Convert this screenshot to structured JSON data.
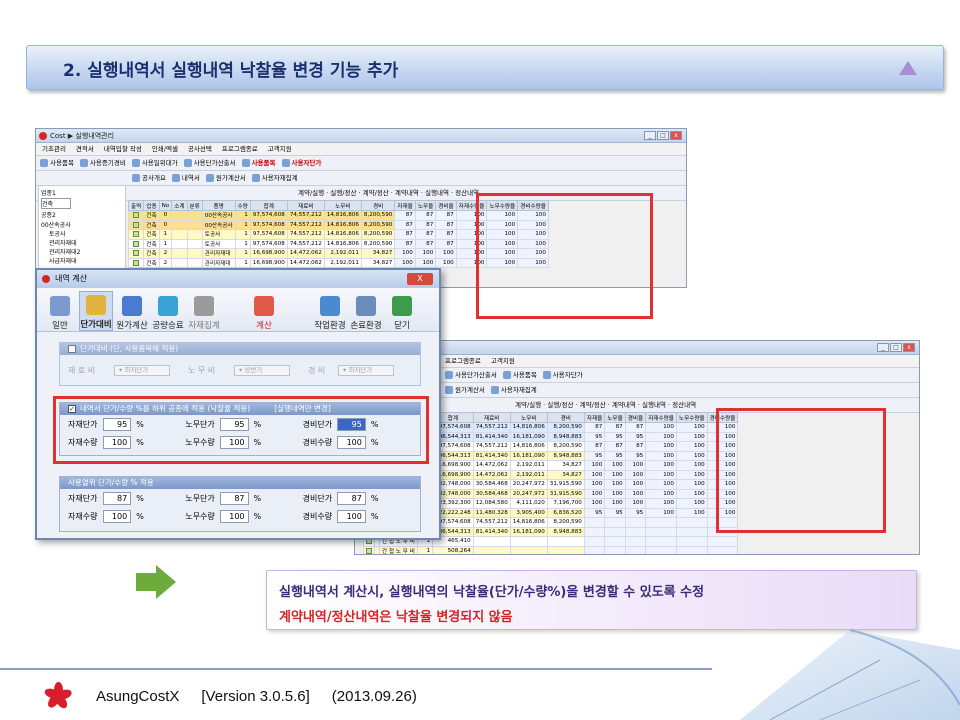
{
  "title": "2. 실행내역서 실행내역 낙찰율 변경 기능 추가",
  "window_back": {
    "title": "Cost ▶ 실행내역관리",
    "menu": [
      "기초관리",
      "견적서",
      "내역입찰 작성",
      "인쇄/엑셀",
      "공사선택",
      "프로그램종료",
      "고객지원"
    ],
    "toolbar": [
      "사용품목",
      "사용증기경비",
      "사용일위대가",
      "사용단가산출서",
      "사용품목",
      "사용자단가"
    ],
    "toolbar_red": [
      "사용품목",
      "사용자단가"
    ],
    "subtool": [
      "공사개요",
      "내역서",
      "원가계산서",
      "사용자재집계"
    ],
    "radio": "계약/실행 · 실행/정산 · 계약/정산 · 계약내역 · 실행내역 · 정산내역",
    "left_labels": [
      "업종1",
      "건축",
      "공종2"
    ],
    "tree": [
      "00산속공사",
      "토공사",
      "관리자재대",
      "관리자재대2",
      "사급자재대"
    ],
    "headers": [
      "출력",
      "업종",
      "No",
      "소계",
      "분류",
      "품명",
      "수량",
      "합계",
      "재료비",
      "노무비",
      "경비",
      "자재율",
      "노무율",
      "경비율",
      "자재수량율",
      "노무수량율",
      "경비수량율"
    ],
    "rows": [
      {
        "cat": "건축",
        "no": "0",
        "name": "00산속공사",
        "qty": "1",
        "sum": "97,574,608",
        "mat": "74,557,212",
        "lab": "14,816,806",
        "exp": "8,200,590",
        "r": [
          "87",
          "87",
          "87",
          "100",
          "100",
          "100"
        ]
      },
      {
        "cat": "건축",
        "no": "0",
        "name": "00산속공사",
        "qty": "1",
        "sum": "97,574,608",
        "mat": "74,557,212",
        "lab": "14,816,806",
        "exp": "8,200,590",
        "r": [
          "87",
          "87",
          "87",
          "100",
          "100",
          "100"
        ]
      },
      {
        "cat": "건축",
        "no": "1",
        "name": "토공사",
        "qty": "1",
        "sum": "97,574,608",
        "mat": "74,557,212",
        "lab": "14,816,806",
        "exp": "8,200,590",
        "r": [
          "87",
          "87",
          "87",
          "100",
          "100",
          "100"
        ]
      },
      {
        "cat": "건축",
        "no": "1",
        "name": "토공사",
        "qty": "1",
        "sum": "97,574,608",
        "mat": "74,557,212",
        "lab": "14,816,806",
        "exp": "8,200,590",
        "r": [
          "87",
          "87",
          "87",
          "100",
          "100",
          "100"
        ]
      },
      {
        "cat": "건축",
        "no": "2",
        "name": "관리자재대",
        "qty": "1",
        "sum": "16,698,900",
        "mat": "14,472,062",
        "lab": "2,192,011",
        "exp": "34,827",
        "r": [
          "100",
          "100",
          "100",
          "100",
          "100",
          "100"
        ]
      },
      {
        "cat": "건축",
        "no": "2",
        "name": "관리자재대",
        "qty": "1",
        "sum": "16,698,900",
        "mat": "14,472,062",
        "lab": "2,192,011",
        "exp": "34,827",
        "r": [
          "100",
          "100",
          "100",
          "100",
          "100",
          "100"
        ]
      }
    ],
    "extra_exp": [
      "31,915,590",
      "31,915,590",
      "7,196,700",
      "7,196,700",
      "8,200,590",
      "8,200,590"
    ]
  },
  "window_front": {
    "menu": [
      "프로그램종료",
      "고객지원"
    ],
    "toolbar": [
      "사용단가산출서",
      "사용품목",
      "사용자단가"
    ],
    "subtool": [
      "원가계산서",
      "사용자재집계"
    ],
    "headers": [
      "품명",
      "수량",
      "합계",
      "재료비",
      "노무비",
      "경비",
      "자재율",
      "노무율",
      "경비율",
      "자재수량율",
      "노무수량율",
      "경비수량율"
    ],
    "rows": [
      {
        "name": "00산속공사",
        "qty": "1",
        "sum": "97,574,608",
        "mat": "74,557,212",
        "lab": "14,816,806",
        "exp": "8,200,590",
        "r": [
          "87",
          "87",
          "87",
          "100",
          "100",
          "100"
        ]
      },
      {
        "name": "00산속공사",
        "qty": "1",
        "sum": "106,544,313",
        "mat": "81,414,340",
        "lab": "16,181,090",
        "exp": "8,948,883",
        "r": [
          "95",
          "95",
          "95",
          "100",
          "100",
          "100"
        ]
      },
      {
        "name": "토공사",
        "qty": "1",
        "sum": "97,574,608",
        "mat": "74,557,212",
        "lab": "14,816,806",
        "exp": "8,200,590",
        "r": [
          "87",
          "87",
          "87",
          "100",
          "100",
          "100"
        ]
      },
      {
        "name": "토공사",
        "qty": "1",
        "sum": "106,544,313",
        "mat": "81,414,340",
        "lab": "16,181,090",
        "exp": "8,948,883",
        "r": [
          "95",
          "95",
          "95",
          "100",
          "100",
          "100"
        ]
      },
      {
        "name": "관리자재대",
        "qty": "1",
        "sum": "16,698,900",
        "mat": "14,472,062",
        "lab": "2,192,011",
        "exp": "34,827",
        "r": [
          "100",
          "100",
          "100",
          "100",
          "100",
          "100"
        ]
      },
      {
        "name": "관리자재대",
        "qty": "1",
        "sum": "16,698,900",
        "mat": "14,472,062",
        "lab": "2,192,011",
        "exp": "34,827",
        "r": [
          "100",
          "100",
          "100",
          "100",
          "100",
          "100"
        ]
      },
      {
        "name": "관리자재대2",
        "qty": "1",
        "sum": "82,748,000",
        "mat": "30,584,468",
        "lab": "20,247,972",
        "exp": "31,915,590",
        "r": [
          "100",
          "100",
          "100",
          "100",
          "100",
          "100"
        ]
      },
      {
        "name": "관리자재대2",
        "qty": "1",
        "sum": "82,748,000",
        "mat": "30,584,468",
        "lab": "20,247,972",
        "exp": "31,915,590",
        "r": [
          "100",
          "100",
          "100",
          "100",
          "100",
          "100"
        ]
      },
      {
        "name": "사급자재대",
        "qty": "1",
        "sum": "23,392,300",
        "mat": "12,084,580",
        "lab": "4,111,020",
        "exp": "7,196,700",
        "r": [
          "100",
          "100",
          "100",
          "100",
          "100",
          "100"
        ]
      },
      {
        "name": "사급자재대",
        "qty": "1",
        "sum": "22,222,248",
        "mat": "11,480,328",
        "lab": "3,905,400",
        "exp": "6,836,520",
        "r": [
          "95",
          "95",
          "95",
          "100",
          "100",
          "100"
        ]
      },
      {
        "name": "소 계",
        "qty": "1",
        "sum": "97,574,608",
        "mat": "74,557,212",
        "lab": "14,816,806",
        "exp": "8,200,590",
        "r": [
          "",
          "",
          "",
          "",
          "",
          ""
        ]
      },
      {
        "name": "소 계",
        "qty": "1",
        "sum": "106,544,313",
        "mat": "81,414,340",
        "lab": "16,181,090",
        "exp": "8,948,883",
        "r": [
          "",
          "",
          "",
          "",
          "",
          ""
        ]
      },
      {
        "name": "간 접 노 무 비",
        "qty": "1",
        "sum": "465,410",
        "mat": "",
        "lab": "",
        "exp": "",
        "r": [
          "",
          "",
          "",
          "",
          "",
          ""
        ]
      },
      {
        "name": "간 접 노 무 비",
        "qty": "1",
        "sum": "508,264",
        "mat": "",
        "lab": "",
        "exp": "",
        "r": [
          "",
          "",
          "",
          "",
          "",
          ""
        ]
      }
    ]
  },
  "dialog": {
    "title": "내역 계산",
    "close": "X",
    "tools": [
      "일반",
      "단가대비",
      "원가계산",
      "공량승료",
      "자재집계",
      "계산",
      "작업환경",
      "손료환경",
      "닫기"
    ],
    "group1": {
      "header": "단가대비 (단, 사용품목에 적용)",
      "mat_label": "재 료 비",
      "mat_value": "최저단가",
      "lab_label": "노 무 비",
      "lab_value": "상반기",
      "exp_label": "경 비",
      "exp_value": "최저단가"
    },
    "group2": {
      "header": "내역서 단가/수량 %를 하위 공종에 적용 (낙찰율 적용)",
      "header_note": "[실행내역만 변경]",
      "fields": [
        {
          "label": "자재단가",
          "value": "95"
        },
        {
          "label": "노무단가",
          "value": "95"
        },
        {
          "label": "경비단가",
          "value": "95"
        },
        {
          "label": "자재수량",
          "value": "100"
        },
        {
          "label": "노무수량",
          "value": "100"
        },
        {
          "label": "경비수량",
          "value": "100"
        }
      ]
    },
    "group3": {
      "header": "사용열위 단가/수량 % 적용",
      "fields": [
        {
          "label": "자재단가",
          "value": "87"
        },
        {
          "label": "노무단가",
          "value": "87"
        },
        {
          "label": "경비단가",
          "value": "87"
        },
        {
          "label": "자재수량",
          "value": "100"
        },
        {
          "label": "노무수량",
          "value": "100"
        },
        {
          "label": "경비수량",
          "value": "100"
        }
      ]
    },
    "pct": "%"
  },
  "caption": {
    "line1": "실행내역서 계산시, 실행내역의 낙찰율(단가/수량%)을 변경할 수 있도록 수정",
    "line2": "계약내역/정산내역은 낙찰율 변경되지 않음"
  },
  "footer": {
    "product": "AsungCostX",
    "version": "[Version 3.0.5.6]",
    "date": "(2013.09.26)"
  },
  "colors": {
    "highlight_box": "#e03030",
    "caption_red": "#d42424",
    "accent": "#6dab3a"
  }
}
